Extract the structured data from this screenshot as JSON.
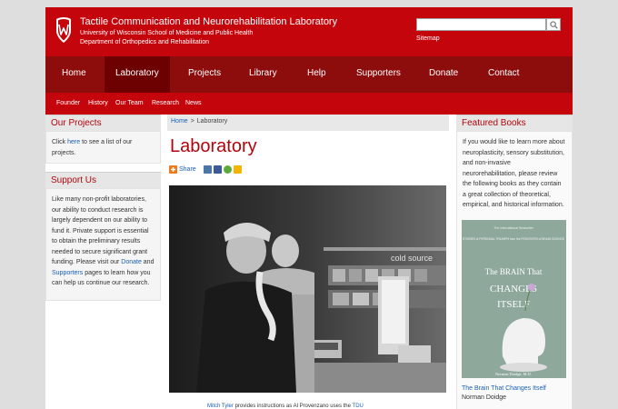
{
  "header": {
    "title": "Tactile Communication and Neurorehabilitation Laboratory",
    "subtitle1": "University of Wisconsin School of Medicine and Public Health",
    "subtitle2": "Department of Orthopedics and Rehabilitation",
    "search_value": "",
    "sitemap": "Sitemap"
  },
  "nav": {
    "items": [
      {
        "label": "Home"
      },
      {
        "label": "Laboratory"
      },
      {
        "label": "Projects"
      },
      {
        "label": "Library"
      },
      {
        "label": "Help"
      },
      {
        "label": "Supporters"
      },
      {
        "label": "Donate"
      },
      {
        "label": "Contact"
      }
    ],
    "active": "Laboratory"
  },
  "subnav": {
    "items": [
      {
        "label": "Founder"
      },
      {
        "label": "History"
      },
      {
        "label": "Our Team"
      },
      {
        "label": "Research"
      },
      {
        "label": "News"
      }
    ]
  },
  "left": {
    "projects": {
      "heading": "Our Projects",
      "text_before": "Click ",
      "link": "here",
      "text_after": " to see a list of our projects."
    },
    "support": {
      "heading": "Support Us",
      "text1": "Like many non-profit laboratories, our ability to conduct research is largely dependent on our ability to fund it. Private support is essential to obtain the preliminary results needed to secure significant grant funding. Please visit our ",
      "link1": "Donate",
      "text2": " and ",
      "link2": "Supporters",
      "text3": " pages to learn how you can help us continue our research."
    }
  },
  "main": {
    "breadcrumb": {
      "home": "Home",
      "separator": ">",
      "current": "Laboratory"
    },
    "title": "Laboratory",
    "share_label": "Share",
    "photo_lettering": "cold source",
    "caption_link1": "Mitch Tyler",
    "caption_text": " provides instructions as Al Provenzano uses the ",
    "caption_link2": "TDU"
  },
  "right": {
    "heading": "Featured Books",
    "intro": "If you would like to learn more about neuroplasticity, sensory substitution, and non-invasive neurorehabilitation, please review the following books as they contain a great collection of theoretical, empirical, and historical information.",
    "book": {
      "cover_top": "The International Bestseller",
      "cover_tagline": "STORIES of PERSONAL TRIUMPH from the FRONTIERS of BRAIN SCIENCE",
      "cover_title_1": "The BRAIN That",
      "cover_title_2": "CHANGES",
      "cover_title_3": "ITSELF",
      "cover_author": "Norman Doidge, M.D.",
      "title": "The Brain That Changes Itself",
      "author": "Norman Doidge"
    }
  },
  "colors": {
    "header_red": "#c5050c",
    "nav_dark": "#8d0c0c",
    "heading_red": "#b0050c",
    "link_blue": "#1a5fb4"
  }
}
